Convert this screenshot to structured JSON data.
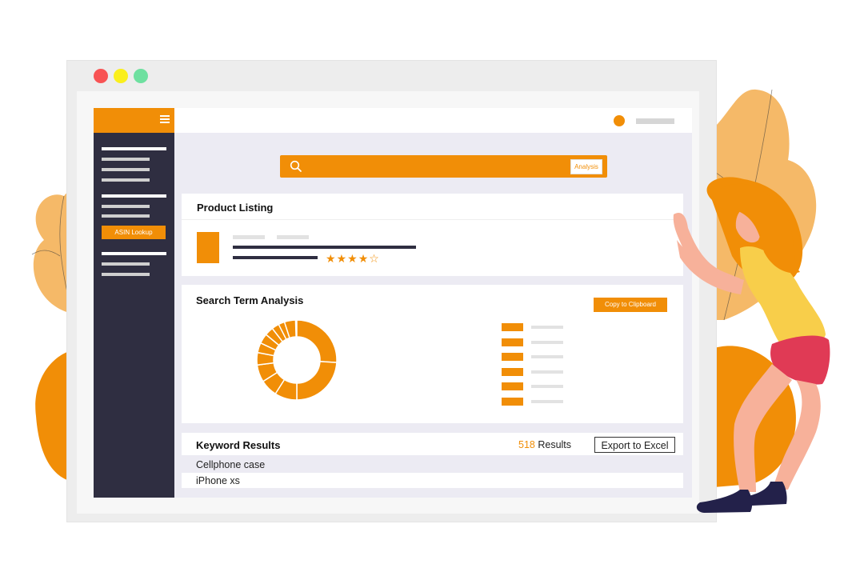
{
  "window": {
    "controls": [
      {
        "name": "close",
        "color": "#f85354"
      },
      {
        "name": "minimize",
        "color": "#faef1c"
      },
      {
        "name": "maximize",
        "color": "#6ee0a0"
      }
    ]
  },
  "sidebar": {
    "menu_icon": "hamburger-menu-icon",
    "asin_button": "ASIN Lookup"
  },
  "search": {
    "icon": "search-icon",
    "analysis_button": "Analysis"
  },
  "product_listing": {
    "title": "Product Listing",
    "rating": {
      "filled": 4,
      "total": 5
    }
  },
  "search_term_analysis": {
    "title": "Search Term Analysis",
    "copy_button": "Copy to Clipboard",
    "legend_items": 6
  },
  "keyword_results": {
    "title": "Keyword Results",
    "count": "518",
    "count_label": "Results",
    "export_button": "Export to Excel",
    "rows": [
      "Cellphone case",
      "iPhone xs"
    ]
  },
  "colors": {
    "accent": "#f18e07",
    "sidebar": "#2f2e41",
    "leaf_light": "#f5b968",
    "leaf_dark": "#f18e07"
  }
}
